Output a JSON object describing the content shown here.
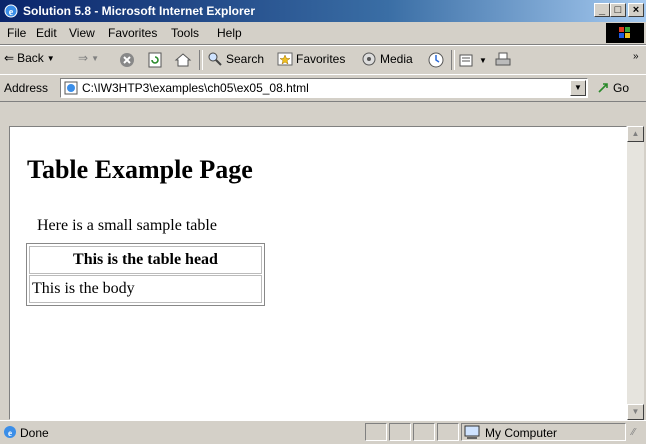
{
  "window": {
    "title": "Solution 5.8 - Microsoft Internet Explorer"
  },
  "menu": [
    "File",
    "Edit",
    "View",
    "Favorites",
    "Tools",
    "Help"
  ],
  "toolbar": {
    "back": "Back",
    "search": "Search",
    "favorites": "Favorites",
    "media": "Media"
  },
  "address": {
    "label": "Address",
    "url": "C:\\IW3HTP3\\examples\\ch05\\ex05_08.html",
    "go": "Go"
  },
  "page": {
    "heading": "Table Example Page",
    "paragraph": "Here is a small sample table",
    "table": {
      "head": "This is the table head",
      "body": "This is the body"
    }
  },
  "status": {
    "text": "Done",
    "zone": "My Computer"
  }
}
